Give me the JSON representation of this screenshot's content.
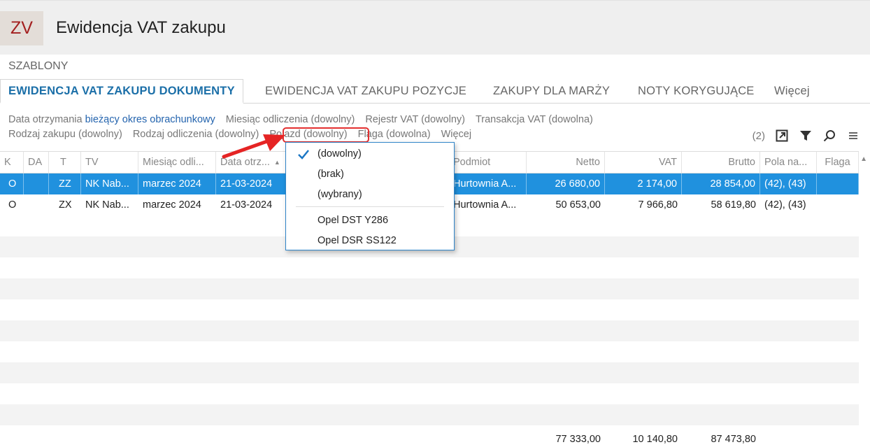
{
  "app": {
    "badge": "ZV",
    "title": "Ewidencja VAT zakupu"
  },
  "szablony": "SZABLONY",
  "tabs": [
    {
      "label": "EWIDENCJA VAT ZAKUPU DOKUMENTY"
    },
    {
      "label": "EWIDENCJA VAT ZAKUPU POZYCJE"
    },
    {
      "label": "ZAKUPY DLA MARŻY"
    },
    {
      "label": "NOTY KORYGUJĄCE"
    },
    {
      "label": "Więcej"
    }
  ],
  "filters": {
    "line1": [
      {
        "label": "Data otrzymania"
      },
      {
        "label": "bieżący okres obrachunkowy"
      },
      {
        "label": "Miesiąc odliczenia (dowolny)"
      },
      {
        "label": "Rejestr VAT (dowolny)"
      },
      {
        "label": "Transakcja VAT (dowolna)"
      }
    ],
    "line2": [
      {
        "label": "Rodzaj zakupu (dowolny)"
      },
      {
        "label": "Rodzaj odliczenia (dowolny)"
      },
      {
        "label": "Pojazd (dowolny)"
      },
      {
        "label": "Flaga (dowolna)"
      },
      {
        "label": "Więcej"
      }
    ]
  },
  "toolbar": {
    "count": "(2)",
    "icons": [
      "export-icon",
      "filter-icon",
      "search-icon",
      "menu-icon"
    ]
  },
  "columns": [
    "K",
    "DA",
    "T",
    "TV",
    "Miesiąc odli...",
    "Data otrz...",
    "Podmiot",
    "Netto",
    "VAT",
    "Brutto",
    "Pola na...",
    "Flaga"
  ],
  "rows": [
    {
      "k": "O",
      "da": "",
      "t": "ZZ",
      "tv": "NK Nab...",
      "miesiac": "marzec 2024",
      "data": "21-03-2024",
      "podmiot": "Hurtownia A...",
      "netto": "26 680,00",
      "vat": "2 174,00",
      "brutto": "28 854,00",
      "pola": "(42), (43)",
      "flaga": ""
    },
    {
      "k": "O",
      "da": "",
      "t": "ZX",
      "tv": "NK Nab...",
      "miesiac": "marzec 2024",
      "data": "21-03-2024",
      "podmiot": "Hurtownia A...",
      "netto": "50 653,00",
      "vat": "7 966,80",
      "brutto": "58 619,80",
      "pola": "(42), (43)",
      "flaga": ""
    }
  ],
  "totals": {
    "netto": "77 333,00",
    "vat": "10 140,80",
    "brutto": "87 473,80"
  },
  "dropdown": {
    "selected": "(dowolny)",
    "options": [
      "(dowolny)",
      "(brak)",
      "(wybrany)",
      "Opel DST Y286",
      "Opel DSR SS122"
    ]
  },
  "colors": {
    "accent": "#2091de",
    "brand": "#a31f1f",
    "highlight": "#e33030"
  }
}
